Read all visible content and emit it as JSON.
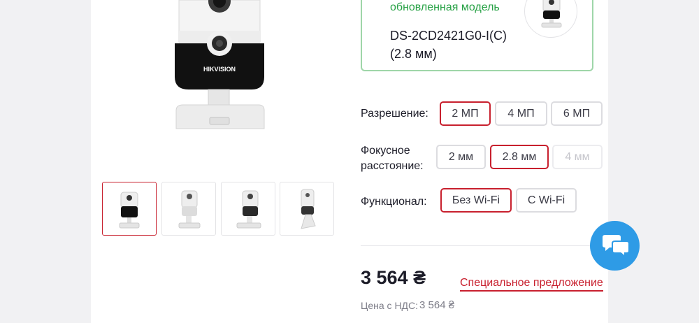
{
  "product": {
    "image_alt": "HIKVISION",
    "thumbnails": [
      {
        "label": "thumbnail-1",
        "active": true
      },
      {
        "label": "thumbnail-2",
        "active": false
      },
      {
        "label": "thumbnail-3",
        "active": false
      },
      {
        "label": "thumbnail-4",
        "active": false
      }
    ]
  },
  "updated_model": {
    "note": "обновленная модель",
    "name": "DS-2CD2421G0-I(C) (2.8 мм)"
  },
  "options": {
    "resolution": {
      "label": "Разрешение:",
      "values": [
        "2 МП",
        "4 МП",
        "6 МП"
      ],
      "selected": "2 МП"
    },
    "focal": {
      "label": "Фокусное расстояние:",
      "values": [
        "2 мм",
        "2.8 мм",
        "4 мм"
      ],
      "selected": "2.8 мм",
      "disabled": [
        "4 мм"
      ]
    },
    "functional": {
      "label": "Функционал:",
      "values": [
        "Без Wi-Fi",
        "С Wi-Fi"
      ],
      "selected": "Без Wi-Fi"
    }
  },
  "price": {
    "value": "3 564 ₴",
    "special_offer": "Специальное предложение",
    "vat_label": "Цена с НДС:",
    "vat_value": "3 564 ₴"
  },
  "chat": {
    "icon": "chat-bubbles-icon"
  },
  "colors": {
    "accent": "#c8202e",
    "green": "#27a145",
    "chat": "#2e9be6"
  }
}
